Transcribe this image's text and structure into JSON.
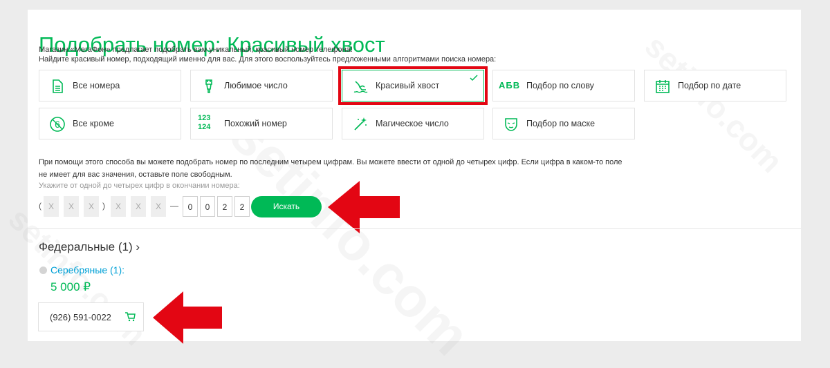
{
  "page": {
    "title": "Подобрать номер: Красивый хвост",
    "desc1": "Магазин «МегаФон» предлагает подобрать вам уникальный, красивый номер телефона!",
    "desc2": "Найдите красивый номер, подходящий именно для вас. Для этого воспользуйтесь предложенными алгоритмами поиска номера:"
  },
  "tiles": [
    {
      "label": "Все номера",
      "icon": "document-icon"
    },
    {
      "label": "Любимое число",
      "icon": "brush-icon"
    },
    {
      "label": "Красивый хвост",
      "icon": "tail-icon",
      "selected": true
    },
    {
      "label": "Подбор по слову",
      "icon_text": "АБВ"
    },
    {
      "label": "Подбор по дате",
      "icon": "calendar-icon"
    },
    {
      "label": "Все кроме",
      "icon": "except-six-icon"
    },
    {
      "label": "Похожий номер",
      "icon_text_top": "123",
      "icon_text_bottom": "124"
    },
    {
      "label": "Магическое число",
      "icon": "magic-wand-icon"
    },
    {
      "label": "Подбор по маске",
      "icon": "mask-icon"
    }
  ],
  "info": {
    "text": "При помощи этого способа вы можете подобрать номер по последним четырем цифрам. Вы можете ввести от одной до четырех цифр. Если цифра в каком-то поле не имеет для вас значения, оставьте поле свободным.",
    "hint": "Укажите от одной до четырех цифр в окончании номера:"
  },
  "number_input": {
    "open_paren": "(",
    "close_paren": ")",
    "dash": "—",
    "placeholder": "X",
    "digits": [
      "0",
      "0",
      "2",
      "2"
    ]
  },
  "search_button": "Искать",
  "results": {
    "federal": "Федеральные (1) ›",
    "silver": "Серебряные (1):",
    "price": "5 000 ₽",
    "number": "(926) 591-0022"
  },
  "watermark": "setinfo.com",
  "colors": {
    "accent": "#00b956",
    "link": "#00a0d6",
    "arrow": "#e30613"
  }
}
